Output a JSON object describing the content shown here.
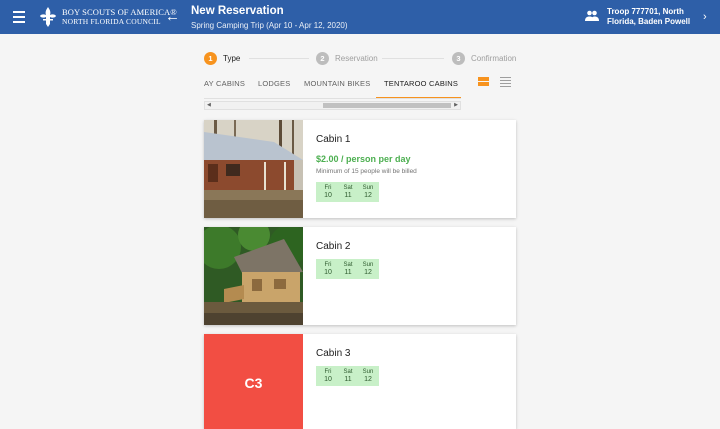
{
  "header": {
    "logo_line1": "BOY SCOUTS OF AMERICA®",
    "logo_line2": "NORTH FLORIDA COUNCIL",
    "title": "New Reservation",
    "subtitle": "Spring Camping Trip (Apr 10 - Apr 12, 2020)",
    "troop_line1": "Troop 777701, North",
    "troop_line2": "Florida, Baden Powell"
  },
  "stepper": [
    {
      "num": "1",
      "label": "Type"
    },
    {
      "num": "2",
      "label": "Reservation"
    },
    {
      "num": "3",
      "label": "Confirmation"
    }
  ],
  "tabs": [
    "AY CABINS",
    "LODGES",
    "MOUNTAIN BIKES",
    "TENTAROO CABINS"
  ],
  "scroll": {
    "left_arrow": "◀",
    "right_arrow": "▶"
  },
  "cards": [
    {
      "title": "Cabin 1",
      "price": "$2.00 / person per day",
      "note": "Minimum of 15 people will be billed",
      "days": [
        {
          "d": "Fri",
          "n": "10"
        },
        {
          "d": "Sat",
          "n": "11"
        },
        {
          "d": "Sun",
          "n": "12"
        }
      ]
    },
    {
      "title": "Cabin 2",
      "days": [
        {
          "d": "Fri",
          "n": "10"
        },
        {
          "d": "Sat",
          "n": "11"
        },
        {
          "d": "Sun",
          "n": "12"
        }
      ]
    },
    {
      "title": "Cabin 3",
      "placeholder": "C3",
      "days": [
        {
          "d": "Fri",
          "n": "10"
        },
        {
          "d": "Sat",
          "n": "11"
        },
        {
          "d": "Sun",
          "n": "12"
        }
      ]
    }
  ],
  "icons": {
    "menu": "menu-icon",
    "back": "arrow-left-icon",
    "troop": "group-icon",
    "chevron": "chevron-right-icon"
  },
  "colors": {
    "header": "#2e5fa8",
    "accent": "#f7931e",
    "price": "#4caf50",
    "placeholder": "#f24e43",
    "day_badge": "#c8f0c8"
  }
}
